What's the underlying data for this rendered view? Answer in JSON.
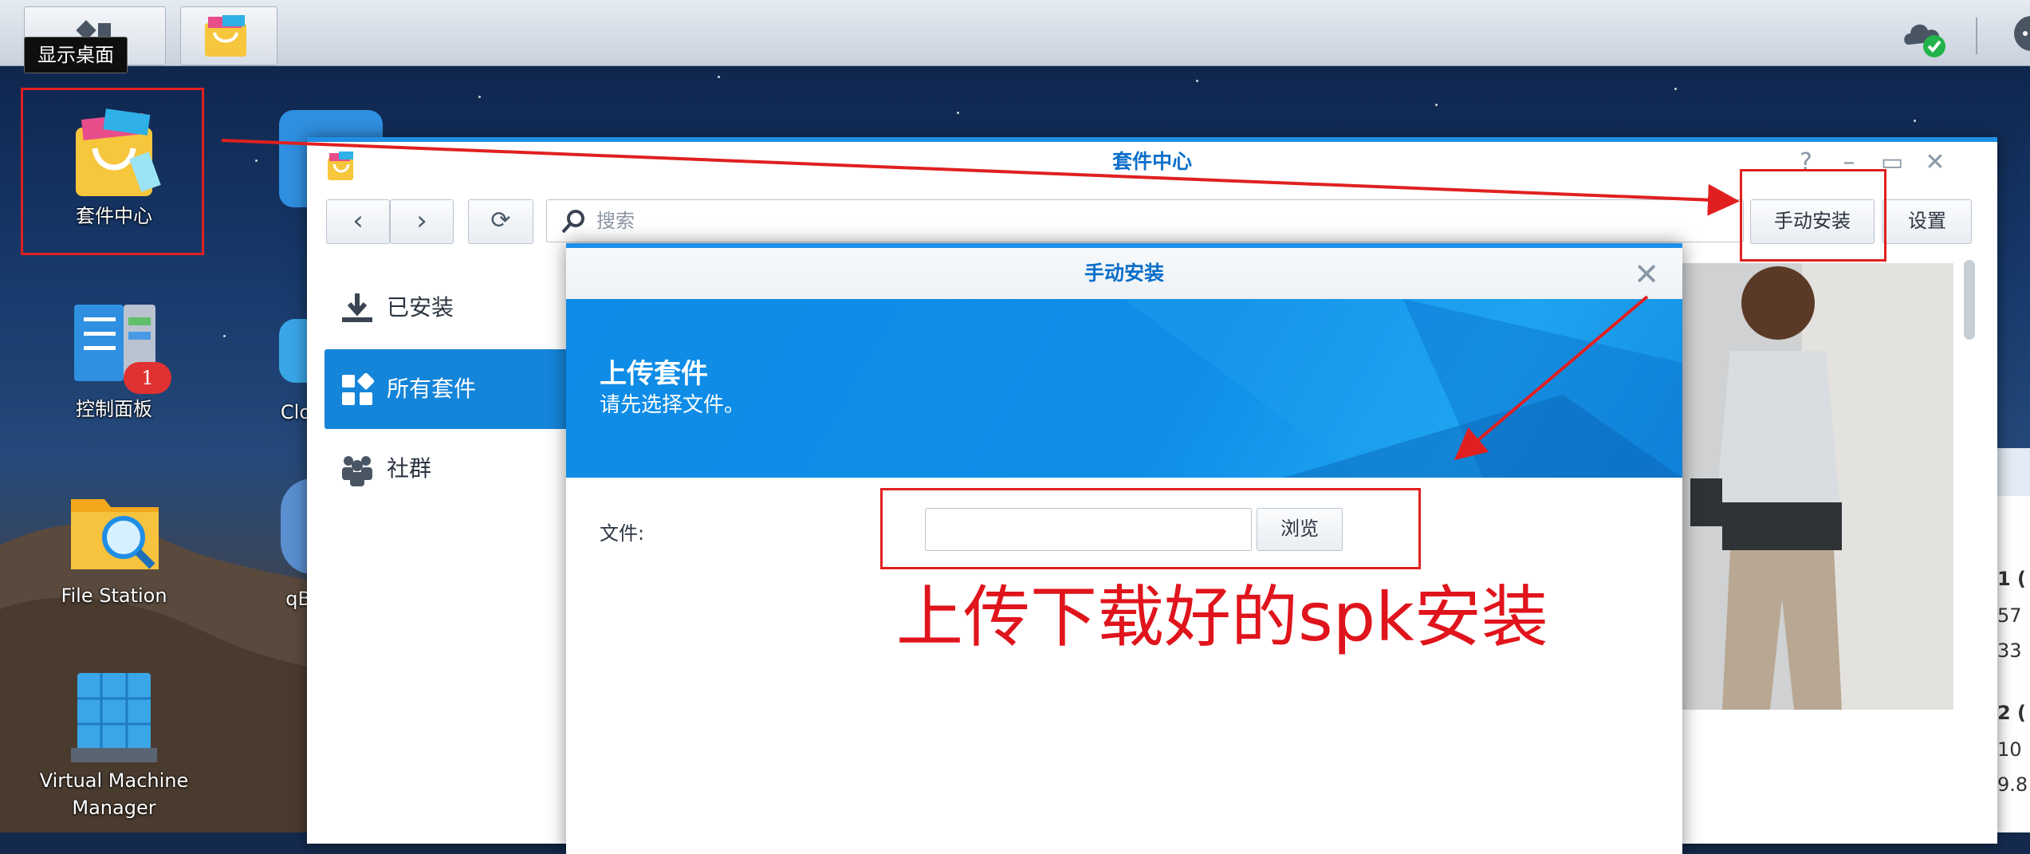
{
  "taskbar": {
    "show_desktop_tooltip": "显示桌面"
  },
  "desktop": {
    "icons": [
      {
        "label": "套件中心"
      },
      {
        "label": "控制面板",
        "badge": "1"
      },
      {
        "label": "File Station"
      },
      {
        "label": "Virtual Machine Manager"
      },
      {
        "label": "Clo"
      },
      {
        "label": "qB"
      }
    ]
  },
  "window": {
    "title": "套件中心",
    "search_placeholder": "搜索",
    "manual_install_label": "手动安装",
    "settings_label": "设置",
    "sidebar": [
      {
        "label": "已安装",
        "icon": "download-icon"
      },
      {
        "label": "所有套件",
        "icon": "grid-icon",
        "active": true
      },
      {
        "label": "社群",
        "icon": "people-icon"
      }
    ]
  },
  "dialog": {
    "title": "手动安装",
    "banner_heading": "上传套件",
    "banner_subtitle": "请先选择文件。",
    "file_label": "文件:",
    "browse_label": "浏览"
  },
  "annotation": {
    "text": "上传下载好的spk安装",
    "color": "#e0141c"
  },
  "right_edge": {
    "texts": [
      "1 (",
      "57",
      "33",
      "2 (",
      "10",
      "9.8"
    ]
  },
  "colors": {
    "accent": "#1585d9",
    "title_text": "#0b6fc9",
    "annotation_red": "#e02020"
  }
}
